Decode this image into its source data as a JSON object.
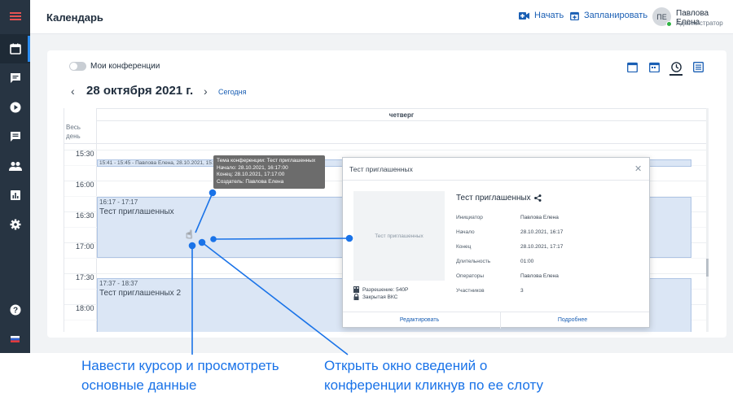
{
  "header": {
    "title": "Календарь",
    "start_label": "Начать",
    "schedule_label": "Запланировать",
    "avatar_initials": "ПЕ",
    "user_name": "Павлова Елена",
    "user_role": "Администратор"
  },
  "sidebar": {
    "items": [
      {
        "icon": "calendar-icon",
        "active": true
      },
      {
        "icon": "chat-box-icon"
      },
      {
        "icon": "play-circle-icon"
      },
      {
        "icon": "message-icon"
      },
      {
        "icon": "users-icon"
      },
      {
        "icon": "bar-chart-icon"
      },
      {
        "icon": "gear-icon"
      },
      {
        "icon": "help-icon"
      },
      {
        "icon": "flag-icon"
      }
    ]
  },
  "toolbar": {
    "my_conferences_label": "Мои конференции",
    "my_conferences_on": false,
    "date_title": "28 октября 2021 г.",
    "prev_glyph": "‹",
    "next_glyph": "›",
    "today_label": "Сегодня",
    "active_view": "day"
  },
  "grid": {
    "day_header": "четверг",
    "allday_label": "Весь день",
    "time_labels": [
      "15:30",
      "16:00",
      "16:30",
      "17:00",
      "17:30",
      "18:00"
    ],
    "events": [
      {
        "time": "15:41 - 15:45 - Павлова Елена, 28.10.2021, 15:45:00",
        "title": ""
      },
      {
        "time": "16:17 - 17:17",
        "title": "Тест приглашенных"
      },
      {
        "time": "17:37 - 18:37",
        "title": "Тест приглашенных 2"
      }
    ]
  },
  "tooltip": {
    "line1": "Тема конференции: Тест приглашенных",
    "line2": "Начало: 28.10.2021, 16:17:00",
    "line3": "Конец: 28.10.2021, 17:17:00",
    "line4": "Создатель: Павлова Елена"
  },
  "popup": {
    "header": "Тест приглашенных",
    "image_placeholder": "Тест приглашенных",
    "resolution": "Разрешение: 540P",
    "closed": "Закрытая ВКС",
    "title": "Тест приглашенных",
    "rows": [
      {
        "key": "Инициатор",
        "value": "Павлова Елена"
      },
      {
        "key": "Начало",
        "value": "28.10.2021, 16:17"
      },
      {
        "key": "Конец",
        "value": "28.10.2021, 17:17"
      },
      {
        "key": "Длительность",
        "value": "01:00"
      },
      {
        "key": "Операторы",
        "value": "Павлова Елена"
      },
      {
        "key": "Участников",
        "value": "3"
      }
    ],
    "edit_label": "Редактировать",
    "more_label": "Подробнее"
  },
  "annotations": {
    "left_line1": "Навести курсор и просмотреть",
    "left_line2": "основные данные",
    "right_line1": "Открыть окно сведений о",
    "right_line2": "конференции кликнув по ее слоту",
    "color": "#1a73e8"
  },
  "colors": {
    "sidebar": "#273442",
    "accent": "#1a5fb4",
    "event_fill": "#dbe6f5"
  }
}
